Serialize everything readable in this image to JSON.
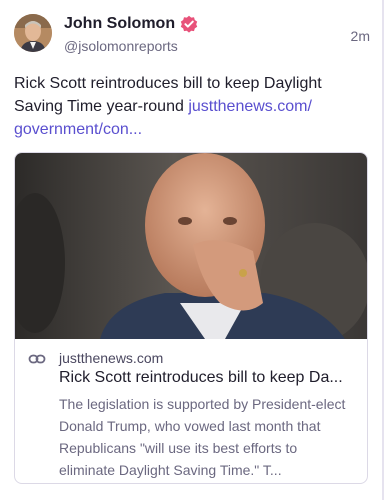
{
  "post": {
    "author": {
      "display_name": "John Solomon",
      "handle": "@jsolomonreports",
      "verified_icon": "verified-badge-icon",
      "badge_color": "#e8527a"
    },
    "timestamp": "2m",
    "text": "Rick Scott reintroduces bill to keep Daylight Saving Time year-round ",
    "link_text": "justthenews.com/ government/con...",
    "link_color": "#5a4fcf"
  },
  "link_card": {
    "link_icon": "link-icon",
    "domain": "justthenews.com",
    "title": "Rick Scott reintroduces bill to keep Da...",
    "description": "The legislation is supported by President-elect Donald Trump, who vowed last month that Republicans \"will use its best efforts to eliminate Daylight Saving Time.\" T..."
  }
}
